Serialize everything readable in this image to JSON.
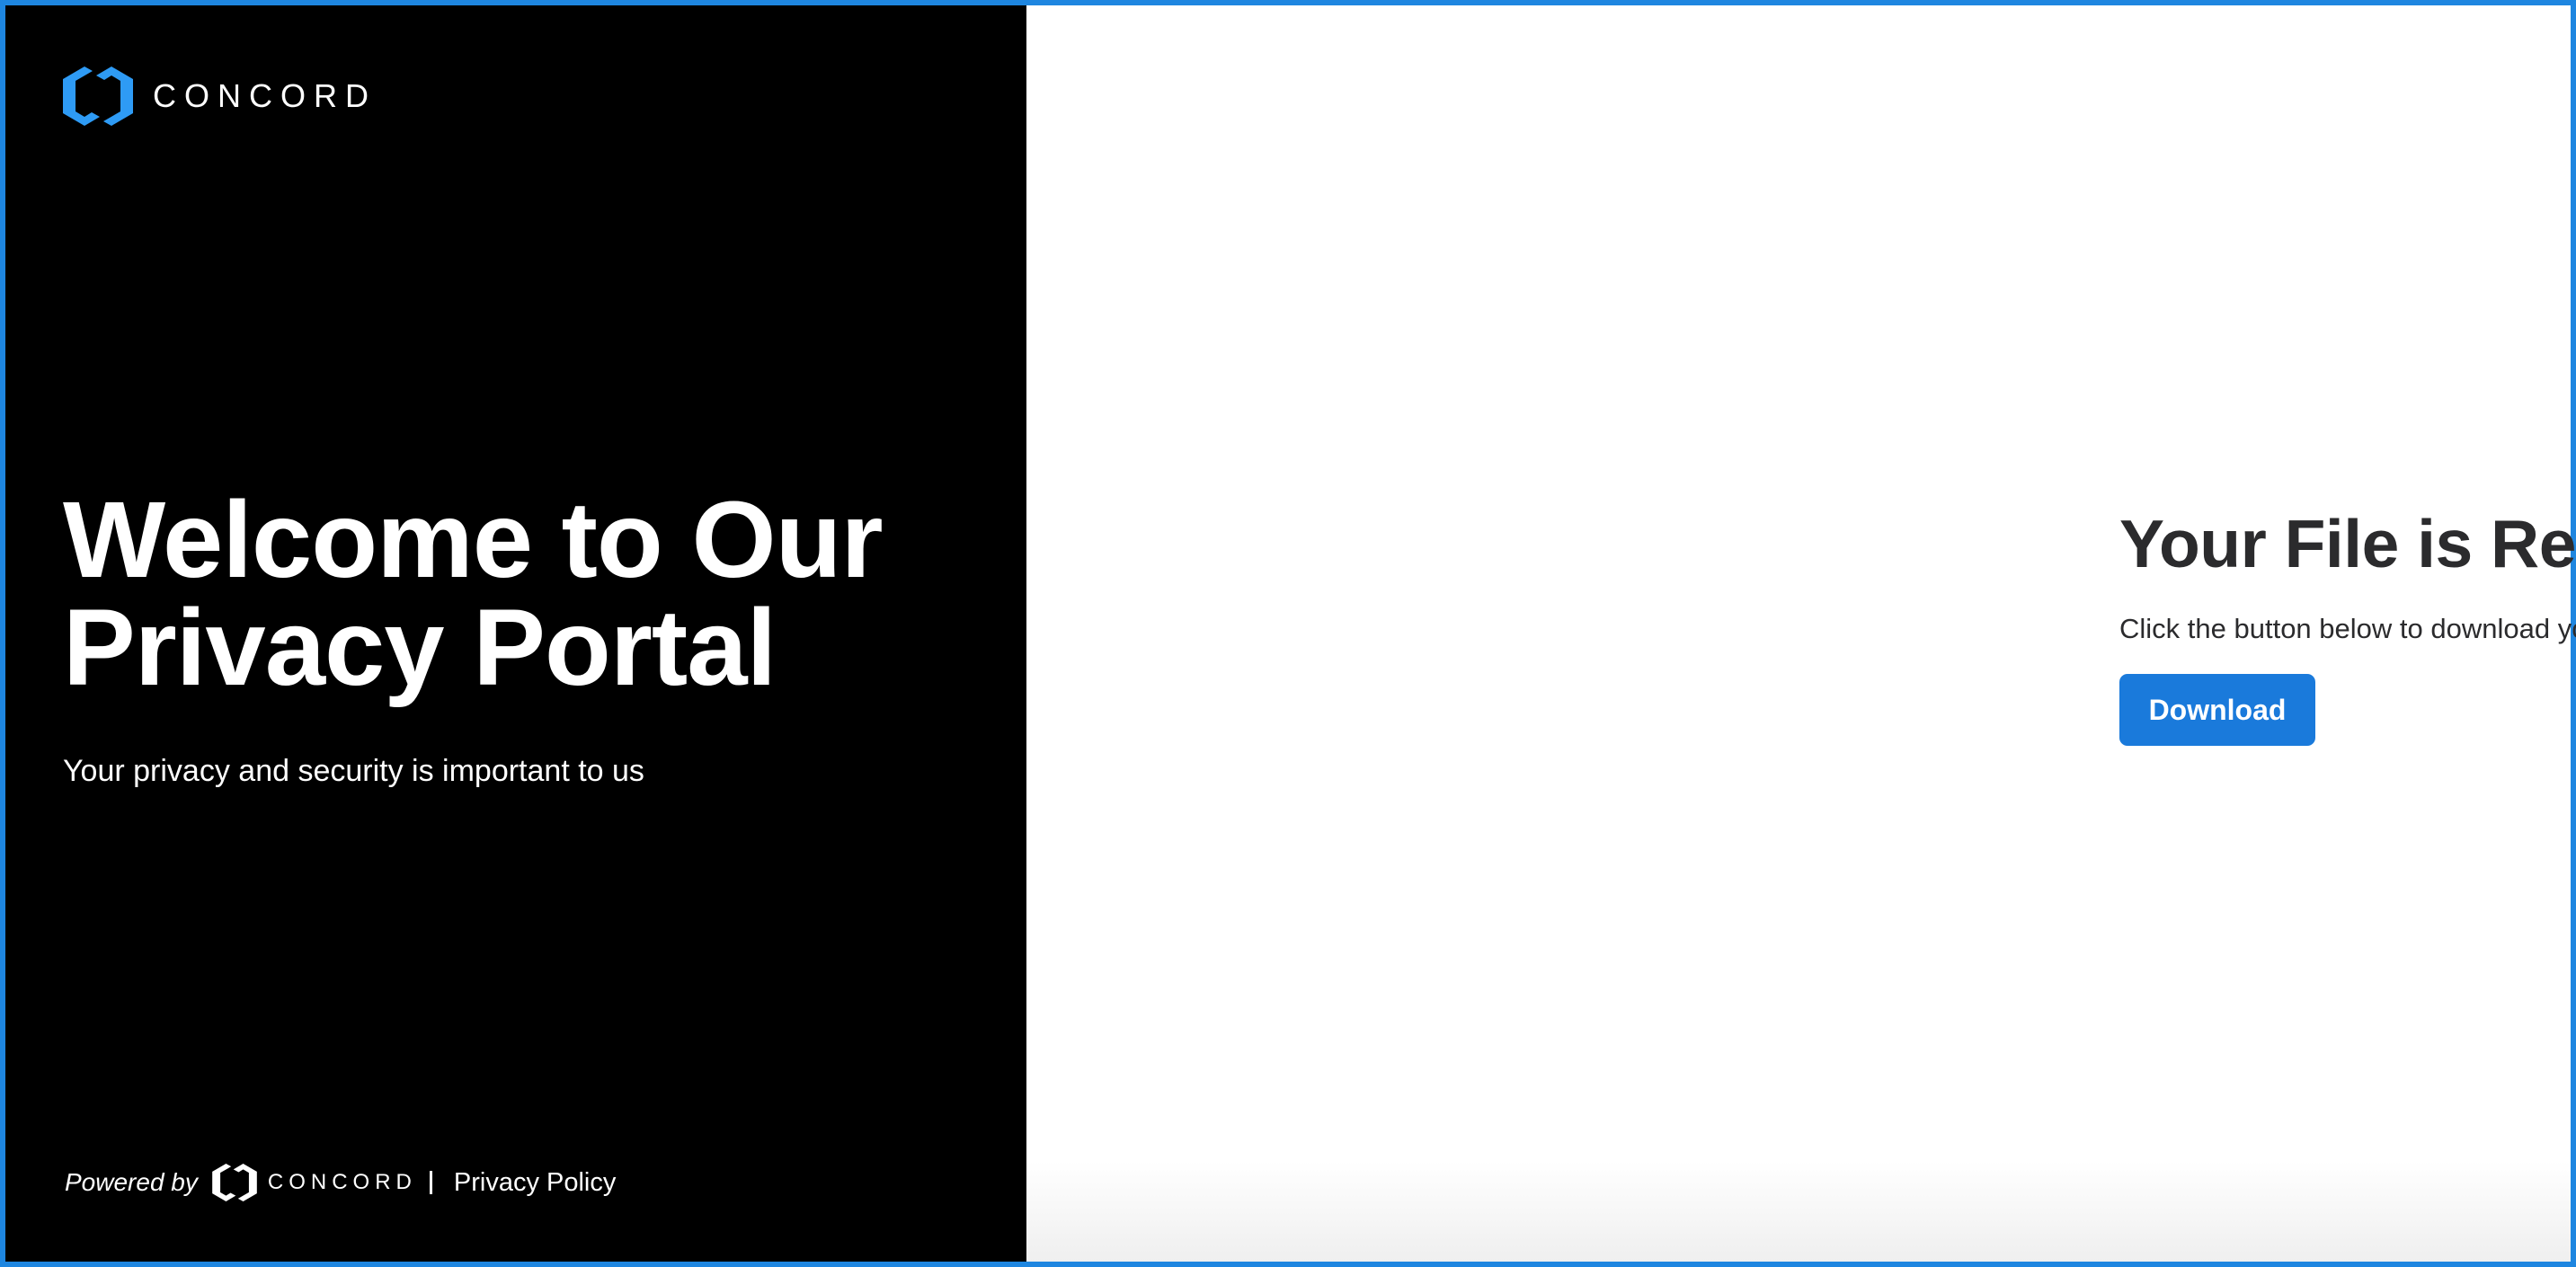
{
  "brand": {
    "name": "CONCORD",
    "logo_icon": "concord-hexagon-logo",
    "accent_color": "#2e9bf5"
  },
  "hero": {
    "title": "Welcome to Our Privacy Portal",
    "subtitle": "Your privacy and security is important to us"
  },
  "footer": {
    "powered_by": "Powered by",
    "brand_name": "CONCORD",
    "separator": "|",
    "privacy_policy": "Privacy Policy"
  },
  "main": {
    "heading": "Your File is Ready to Download",
    "description": "Click the button below to download your file.",
    "download_label": "Download",
    "button_color": "#1a7adb"
  },
  "frame": {
    "border_color": "#1e86e0"
  }
}
